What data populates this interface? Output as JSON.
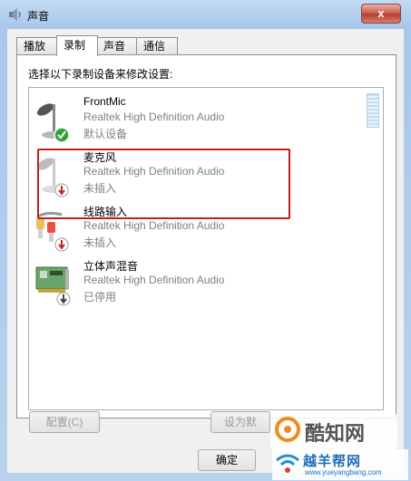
{
  "window": {
    "title": "声音",
    "close_glyph": "x"
  },
  "tabs": [
    {
      "label": "播放",
      "active": false
    },
    {
      "label": "录制",
      "active": true
    },
    {
      "label": "声音",
      "active": false
    },
    {
      "label": "通信",
      "active": false
    }
  ],
  "instruction": "选择以下录制设备来修改设置:",
  "devices": [
    {
      "name": "FrontMic",
      "driver": "Realtek High Definition Audio",
      "status": "默认设备",
      "icon": "microphone-icon",
      "badge": "check-badge-icon"
    },
    {
      "name": "麦克风",
      "driver": "Realtek High Definition Audio",
      "status": "未插入",
      "icon": "microphone-icon",
      "badge": "unplugged-badge-icon"
    },
    {
      "name": "线路输入",
      "driver": "Realtek High Definition Audio",
      "status": "未插入",
      "icon": "line-in-cable-icon",
      "badge": "unplugged-badge-icon"
    },
    {
      "name": "立体声混音",
      "driver": "Realtek High Definition Audio",
      "status": "已停用",
      "icon": "sound-card-icon",
      "badge": "disabled-badge-icon"
    }
  ],
  "buttons": {
    "configure": "配置(C)",
    "set_default": "设为默",
    "ok": "确定"
  },
  "watermark": {
    "brand": "酷知网",
    "site_name": "越羊帮网",
    "site_url": "www.yueyangbang.com"
  },
  "colors": {
    "highlight_border": "#c01e1e",
    "check_green": "#2fa53a",
    "badge_red": "#c22a2a"
  }
}
